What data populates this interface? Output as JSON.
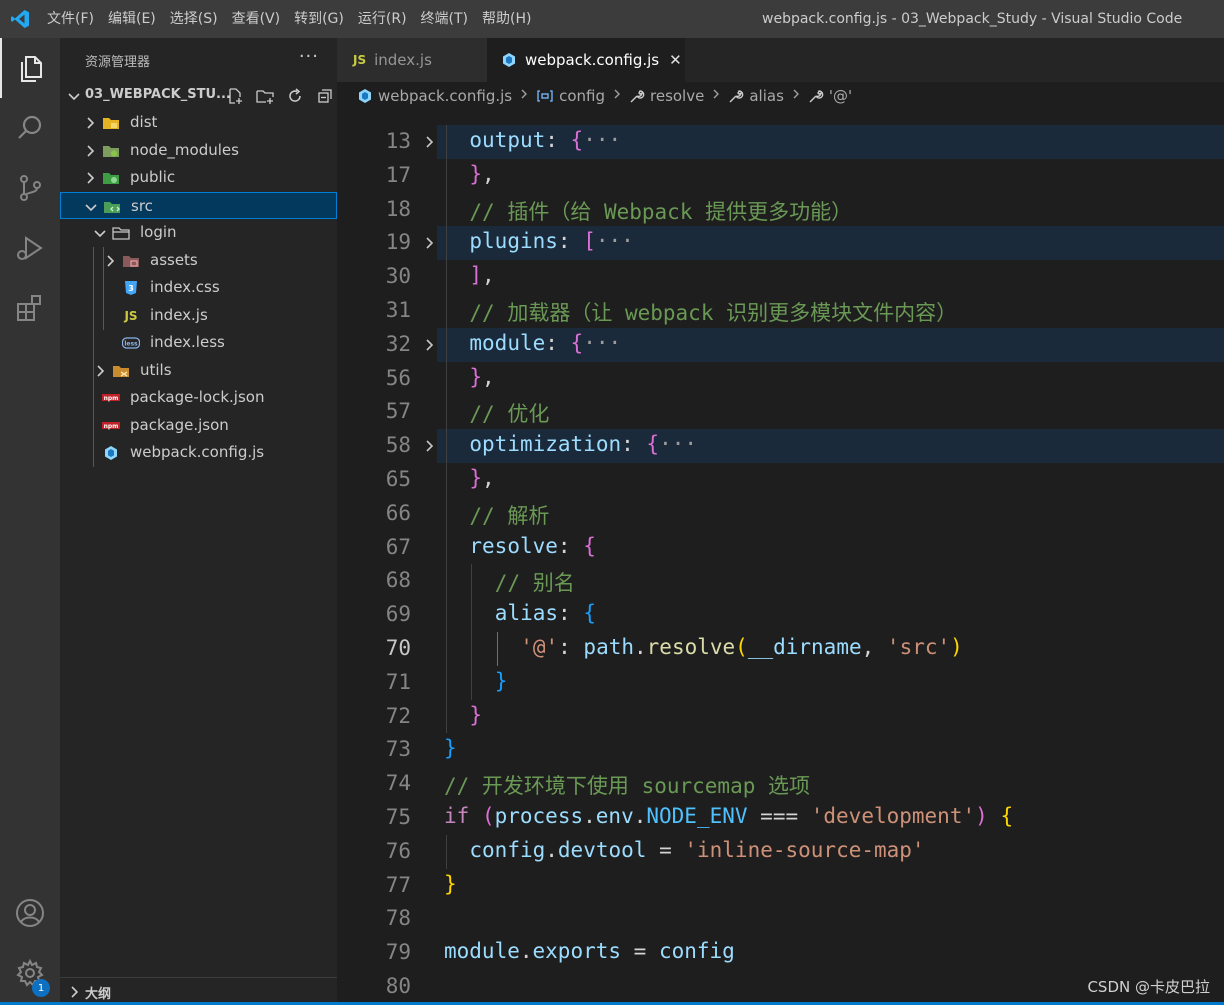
{
  "titlebar": {
    "menu": [
      "文件(F)",
      "编辑(E)",
      "选择(S)",
      "查看(V)",
      "转到(G)",
      "运行(R)",
      "终端(T)",
      "帮助(H)"
    ],
    "window_title": "webpack.config.js - 03_Webpack_Study - Visual Studio Code"
  },
  "activitybar": {
    "items": [
      "explorer-icon",
      "search-icon",
      "source-control-icon",
      "run-debug-icon",
      "extensions-icon"
    ],
    "bottom": [
      "account-icon",
      "settings-gear-icon"
    ],
    "settings_badge": "1"
  },
  "sidebar": {
    "header": "资源管理器",
    "more": "···",
    "project": "03_WEBPACK_STU...",
    "outline": "大纲",
    "tree": [
      {
        "label": "dist",
        "type": "folder",
        "depth": 1,
        "expanded": false,
        "icon": "folder-dist-icon"
      },
      {
        "label": "node_modules",
        "type": "folder",
        "depth": 1,
        "expanded": false,
        "icon": "folder-node-icon"
      },
      {
        "label": "public",
        "type": "folder",
        "depth": 1,
        "expanded": false,
        "icon": "folder-public-icon"
      },
      {
        "label": "src",
        "type": "folder",
        "depth": 1,
        "expanded": true,
        "icon": "folder-src-icon",
        "selected": true
      },
      {
        "label": "login",
        "type": "folder",
        "depth": 2,
        "expanded": true,
        "icon": "folder-icon"
      },
      {
        "label": "assets",
        "type": "folder",
        "depth": 3,
        "expanded": false,
        "icon": "folder-assets-icon"
      },
      {
        "label": "index.css",
        "type": "file",
        "depth": 3,
        "icon": "css-file-icon"
      },
      {
        "label": "index.js",
        "type": "file",
        "depth": 3,
        "icon": "js-file-icon"
      },
      {
        "label": "index.less",
        "type": "file",
        "depth": 3,
        "icon": "less-file-icon"
      },
      {
        "label": "utils",
        "type": "folder",
        "depth": 2,
        "expanded": false,
        "icon": "folder-utils-icon"
      },
      {
        "label": "package-lock.json",
        "type": "file",
        "depth": 1,
        "icon": "npm-file-icon"
      },
      {
        "label": "package.json",
        "type": "file",
        "depth": 1,
        "icon": "npm-file-icon"
      },
      {
        "label": "webpack.config.js",
        "type": "file",
        "depth": 1,
        "icon": "webpack-file-icon"
      }
    ]
  },
  "editor": {
    "tabs": [
      {
        "label": "index.js",
        "badge": "JS",
        "active": false
      },
      {
        "label": "webpack.config.js",
        "active": true,
        "close": "✕"
      }
    ],
    "breadcrumb": [
      "webpack.config.js",
      "config",
      "resolve",
      "alias",
      "'@'"
    ],
    "current_line": "70",
    "lines": [
      {
        "n": "13",
        "fold": true,
        "indent": 1,
        "tokens": [
          [
            "output",
            "prop"
          ],
          [
            ": ",
            "plain"
          ],
          [
            "{",
            "b2"
          ],
          [
            "···",
            "ell"
          ]
        ]
      },
      {
        "n": "17",
        "indent": 1,
        "tokens": [
          [
            "}",
            "b2"
          ],
          [
            ",",
            "plain"
          ]
        ]
      },
      {
        "n": "18",
        "indent": 1,
        "tokens": [
          [
            "// 插件（给 Webpack 提供更多功能）",
            "com"
          ]
        ]
      },
      {
        "n": "19",
        "fold": true,
        "indent": 1,
        "tokens": [
          [
            "plugins",
            "prop"
          ],
          [
            ": ",
            "plain"
          ],
          [
            "[",
            "b2"
          ],
          [
            "···",
            "ell"
          ]
        ]
      },
      {
        "n": "30",
        "indent": 1,
        "tokens": [
          [
            "]",
            "b2"
          ],
          [
            ",",
            "plain"
          ]
        ]
      },
      {
        "n": "31",
        "indent": 1,
        "tokens": [
          [
            "// 加载器（让 webpack 识别更多模块文件内容）",
            "com"
          ]
        ]
      },
      {
        "n": "32",
        "fold": true,
        "indent": 1,
        "tokens": [
          [
            "module",
            "prop"
          ],
          [
            ": ",
            "plain"
          ],
          [
            "{",
            "b2"
          ],
          [
            "···",
            "ell"
          ]
        ]
      },
      {
        "n": "56",
        "indent": 1,
        "tokens": [
          [
            "}",
            "b2"
          ],
          [
            ",",
            "plain"
          ]
        ]
      },
      {
        "n": "57",
        "indent": 1,
        "tokens": [
          [
            "// 优化",
            "com"
          ]
        ]
      },
      {
        "n": "58",
        "fold": true,
        "indent": 1,
        "tokens": [
          [
            "optimization",
            "prop"
          ],
          [
            ": ",
            "plain"
          ],
          [
            "{",
            "b2"
          ],
          [
            "···",
            "ell"
          ]
        ]
      },
      {
        "n": "65",
        "indent": 1,
        "tokens": [
          [
            "}",
            "b2"
          ],
          [
            ",",
            "plain"
          ]
        ]
      },
      {
        "n": "66",
        "indent": 1,
        "tokens": [
          [
            "// 解析",
            "com"
          ]
        ]
      },
      {
        "n": "67",
        "indent": 1,
        "tokens": [
          [
            "resolve",
            "prop"
          ],
          [
            ": ",
            "plain"
          ],
          [
            "{",
            "b2"
          ]
        ]
      },
      {
        "n": "68",
        "indent": 2,
        "tokens": [
          [
            "// 别名",
            "com"
          ]
        ]
      },
      {
        "n": "69",
        "indent": 2,
        "tokens": [
          [
            "alias",
            "prop"
          ],
          [
            ": ",
            "plain"
          ],
          [
            "{",
            "b3"
          ]
        ]
      },
      {
        "n": "70",
        "indent": 3,
        "tokens": [
          [
            "'@'",
            "str"
          ],
          [
            ": ",
            "plain"
          ],
          [
            "path",
            "var"
          ],
          [
            ".",
            "plain"
          ],
          [
            "resolve",
            "fn"
          ],
          [
            "(",
            "b1"
          ],
          [
            "__dirname",
            "var"
          ],
          [
            ", ",
            "plain"
          ],
          [
            "'src'",
            "str"
          ],
          [
            ")",
            "b1"
          ]
        ]
      },
      {
        "n": "71",
        "indent": 2,
        "tokens": [
          [
            "}",
            "b3"
          ]
        ]
      },
      {
        "n": "72",
        "indent": 1,
        "tokens": [
          [
            "}",
            "b2"
          ]
        ]
      },
      {
        "n": "73",
        "indent": 0,
        "tokens": [
          [
            "}",
            "b3"
          ]
        ]
      },
      {
        "n": "74",
        "indent": 0,
        "tokens": [
          [
            "// 开发环境下使用 sourcemap 选项",
            "com"
          ]
        ]
      },
      {
        "n": "75",
        "indent": 0,
        "tokens": [
          [
            "if",
            "ctrl"
          ],
          [
            " ",
            "plain"
          ],
          [
            "(",
            "b2"
          ],
          [
            "process",
            "var"
          ],
          [
            ".",
            "plain"
          ],
          [
            "env",
            "var"
          ],
          [
            ".",
            "plain"
          ],
          [
            "NODE_ENV",
            "const"
          ],
          [
            " === ",
            "plain"
          ],
          [
            "'development'",
            "str"
          ],
          [
            ")",
            "b2"
          ],
          [
            " ",
            "plain"
          ],
          [
            "{",
            "b1"
          ]
        ]
      },
      {
        "n": "76",
        "indent": 1,
        "tokens": [
          [
            "config",
            "var"
          ],
          [
            ".",
            "plain"
          ],
          [
            "devtool",
            "var"
          ],
          [
            " = ",
            "plain"
          ],
          [
            "'inline-source-map'",
            "str"
          ]
        ]
      },
      {
        "n": "77",
        "indent": 0,
        "tokens": [
          [
            "}",
            "b1"
          ]
        ]
      },
      {
        "n": "78",
        "indent": 0,
        "tokens": []
      },
      {
        "n": "79",
        "indent": 0,
        "tokens": [
          [
            "module",
            "var"
          ],
          [
            ".",
            "plain"
          ],
          [
            "exports",
            "var"
          ],
          [
            " = ",
            "plain"
          ],
          [
            "config",
            "var"
          ]
        ]
      },
      {
        "n": "80",
        "indent": 0,
        "tokens": []
      }
    ]
  },
  "watermark": "CSDN @卡皮巴拉",
  "colors": {
    "accent": "#007acc",
    "selection": "#04395e",
    "folded_line": "#1b2a3a"
  }
}
